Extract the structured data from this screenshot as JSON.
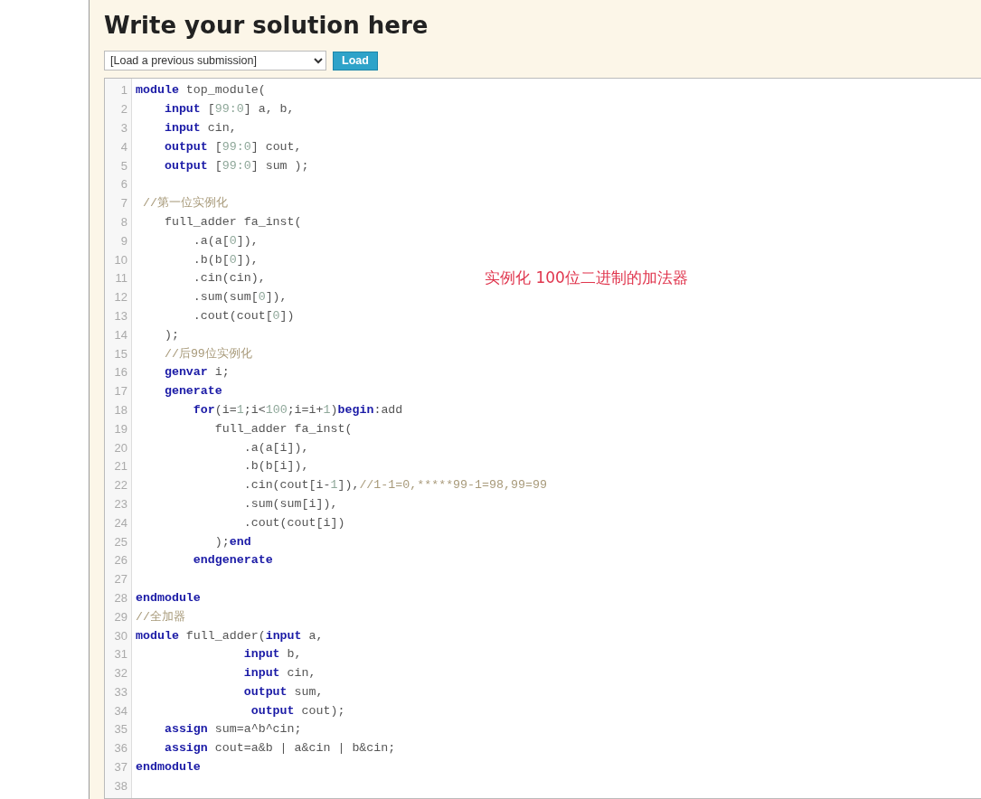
{
  "heading": "Write your solution here",
  "submission_select": {
    "value": "[Load a previous submission]"
  },
  "load_button": "Load",
  "annotation": "实例化 100位二进制的加法器",
  "lines": [
    {
      "number": "1",
      "tokens": [
        {
          "kind": "keyword",
          "text": "module"
        },
        {
          "kind": "plain",
          "text": " top_module("
        }
      ]
    },
    {
      "number": "2",
      "tokens": [
        {
          "kind": "keyword",
          "text": "    input"
        },
        {
          "kind": "plain",
          "text": " ["
        },
        {
          "kind": "number",
          "text": "99:0"
        },
        {
          "kind": "plain",
          "text": "] a, b,"
        }
      ]
    },
    {
      "number": "3",
      "tokens": [
        {
          "kind": "keyword",
          "text": "    input"
        },
        {
          "kind": "plain",
          "text": " cin,"
        }
      ]
    },
    {
      "number": "4",
      "tokens": [
        {
          "kind": "keyword",
          "text": "    output"
        },
        {
          "kind": "plain",
          "text": " ["
        },
        {
          "kind": "number",
          "text": "99:0"
        },
        {
          "kind": "plain",
          "text": "] cout,"
        }
      ]
    },
    {
      "number": "5",
      "tokens": [
        {
          "kind": "keyword",
          "text": "    output"
        },
        {
          "kind": "plain",
          "text": " ["
        },
        {
          "kind": "number",
          "text": "99:0"
        },
        {
          "kind": "plain",
          "text": "] sum );"
        }
      ]
    },
    {
      "number": "6"
    },
    {
      "number": "7",
      "tokens": [
        {
          "kind": "comment",
          "text": " //第一位实例化"
        }
      ]
    },
    {
      "number": "8",
      "tokens": [
        {
          "kind": "plain",
          "text": "    full_adder fa_inst("
        }
      ]
    },
    {
      "number": "9",
      "tokens": [
        {
          "kind": "plain",
          "text": "        .a(a["
        },
        {
          "kind": "number",
          "text": "0"
        },
        {
          "kind": "plain",
          "text": "]),"
        }
      ]
    },
    {
      "number": "10",
      "tokens": [
        {
          "kind": "plain",
          "text": "        .b(b["
        },
        {
          "kind": "number",
          "text": "0"
        },
        {
          "kind": "plain",
          "text": "]),"
        }
      ]
    },
    {
      "number": "11",
      "tokens": [
        {
          "kind": "plain",
          "text": "        .cin(cin),"
        }
      ]
    },
    {
      "number": "12",
      "tokens": [
        {
          "kind": "plain",
          "text": "        .sum(sum["
        },
        {
          "kind": "number",
          "text": "0"
        },
        {
          "kind": "plain",
          "text": "]),"
        }
      ]
    },
    {
      "number": "13",
      "tokens": [
        {
          "kind": "plain",
          "text": "        .cout(cout["
        },
        {
          "kind": "number",
          "text": "0"
        },
        {
          "kind": "plain",
          "text": "])"
        }
      ]
    },
    {
      "number": "14",
      "tokens": [
        {
          "kind": "plain",
          "text": "    );"
        }
      ]
    },
    {
      "number": "15",
      "tokens": [
        {
          "kind": "comment",
          "text": "    //后99位实例化"
        }
      ]
    },
    {
      "number": "16",
      "tokens": [
        {
          "kind": "keyword",
          "text": "    genvar"
        },
        {
          "kind": "plain",
          "text": " i;"
        }
      ]
    },
    {
      "number": "17",
      "tokens": [
        {
          "kind": "keyword",
          "text": "    generate"
        }
      ]
    },
    {
      "number": "18",
      "tokens": [
        {
          "kind": "keyword",
          "text": "        for"
        },
        {
          "kind": "plain",
          "text": "(i="
        },
        {
          "kind": "number",
          "text": "1"
        },
        {
          "kind": "plain",
          "text": ";i<"
        },
        {
          "kind": "number",
          "text": "100"
        },
        {
          "kind": "plain",
          "text": ";i=i+"
        },
        {
          "kind": "number",
          "text": "1"
        },
        {
          "kind": "plain",
          "text": ")"
        },
        {
          "kind": "keyword",
          "text": "begin"
        },
        {
          "kind": "plain",
          "text": ":add"
        }
      ]
    },
    {
      "number": "19",
      "tokens": [
        {
          "kind": "plain",
          "text": "           full_adder fa_inst("
        }
      ]
    },
    {
      "number": "20",
      "tokens": [
        {
          "kind": "plain",
          "text": "               .a(a[i]),"
        }
      ]
    },
    {
      "number": "21",
      "tokens": [
        {
          "kind": "plain",
          "text": "               .b(b[i]),"
        }
      ]
    },
    {
      "number": "22",
      "tokens": [
        {
          "kind": "plain",
          "text": "               .cin(cout[i-"
        },
        {
          "kind": "number",
          "text": "1"
        },
        {
          "kind": "plain",
          "text": "]),"
        },
        {
          "kind": "comment",
          "text": "//1-1=0,*****99-1=98,99=99"
        }
      ]
    },
    {
      "number": "23",
      "tokens": [
        {
          "kind": "plain",
          "text": "               .sum(sum[i]),"
        }
      ]
    },
    {
      "number": "24",
      "tokens": [
        {
          "kind": "plain",
          "text": "               .cout(cout[i])"
        }
      ]
    },
    {
      "number": "25",
      "tokens": [
        {
          "kind": "plain",
          "text": "           );"
        },
        {
          "kind": "keyword",
          "text": "end"
        }
      ]
    },
    {
      "number": "26",
      "tokens": [
        {
          "kind": "keyword",
          "text": "        endgenerate"
        }
      ]
    },
    {
      "number": "27"
    },
    {
      "number": "28",
      "tokens": [
        {
          "kind": "keyword",
          "text": "endmodule"
        }
      ]
    },
    {
      "number": "29",
      "tokens": [
        {
          "kind": "comment",
          "text": "//全加器"
        }
      ]
    },
    {
      "number": "30",
      "tokens": [
        {
          "kind": "keyword",
          "text": "module"
        },
        {
          "kind": "plain",
          "text": " full_adder("
        },
        {
          "kind": "keyword",
          "text": "input"
        },
        {
          "kind": "plain",
          "text": " a,"
        }
      ]
    },
    {
      "number": "31",
      "tokens": [
        {
          "kind": "keyword",
          "text": "               input"
        },
        {
          "kind": "plain",
          "text": " b,"
        }
      ]
    },
    {
      "number": "32",
      "tokens": [
        {
          "kind": "keyword",
          "text": "               input"
        },
        {
          "kind": "plain",
          "text": " cin,"
        }
      ]
    },
    {
      "number": "33",
      "tokens": [
        {
          "kind": "keyword",
          "text": "               output"
        },
        {
          "kind": "plain",
          "text": " sum,"
        }
      ]
    },
    {
      "number": "34",
      "tokens": [
        {
          "kind": "keyword",
          "text": "                output"
        },
        {
          "kind": "plain",
          "text": " cout);"
        }
      ]
    },
    {
      "number": "35",
      "tokens": [
        {
          "kind": "keyword",
          "text": "    assign"
        },
        {
          "kind": "plain",
          "text": " sum=a^b^cin;"
        }
      ]
    },
    {
      "number": "36",
      "tokens": [
        {
          "kind": "keyword",
          "text": "    assign"
        },
        {
          "kind": "plain",
          "text": " cout=a&b | a&cin | b&cin;"
        }
      ]
    },
    {
      "number": "37",
      "tokens": [
        {
          "kind": "keyword",
          "text": "endmodule"
        }
      ]
    },
    {
      "number": "38"
    }
  ]
}
